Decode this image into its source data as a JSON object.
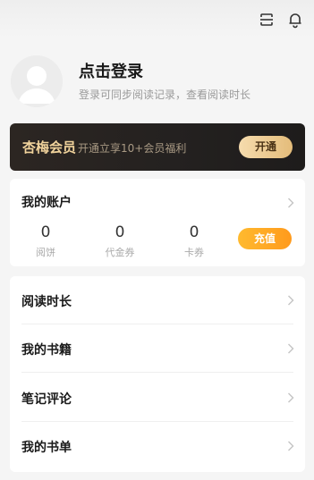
{
  "profile": {
    "login_title": "点击登录",
    "login_subtitle": "登录可同步阅读记录，查看阅读时长"
  },
  "vip": {
    "title": "杏梅会员",
    "description": "开通立享10+会员福利",
    "button_label": "开通"
  },
  "account": {
    "title": "我的账户",
    "items": [
      {
        "value": "0",
        "label": "阅饼"
      },
      {
        "value": "0",
        "label": "代金券"
      },
      {
        "value": "0",
        "label": "卡券"
      }
    ],
    "recharge_label": "充值"
  },
  "menu": {
    "items": [
      {
        "label": "阅读时长"
      },
      {
        "label": "我的书籍"
      },
      {
        "label": "笔记评论"
      },
      {
        "label": "我的书单"
      }
    ]
  },
  "colors": {
    "page_bg": "#f5f5f5",
    "vip_gold": "#f1d39c",
    "recharge_orange": "#ffa522"
  },
  "icons": [
    "scan-icon",
    "bell-icon",
    "avatar-placeholder-icon",
    "chevron-right-icon"
  ]
}
